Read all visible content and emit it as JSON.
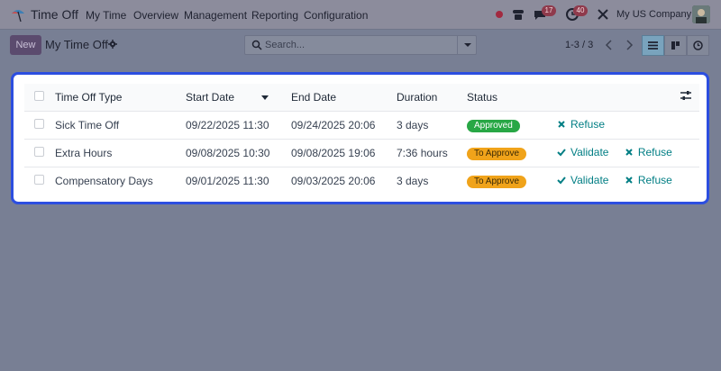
{
  "navbar": {
    "app_name": "Time Off",
    "menu": [
      "My Time",
      "Overview",
      "Management",
      "Reporting",
      "Configuration"
    ],
    "chat_badge": "17",
    "activity_badge": "40",
    "company": "My US Company"
  },
  "control_panel": {
    "new_label": "New",
    "breadcrumb": "My Time Off",
    "search_placeholder": "Search...",
    "pager": "1-3 / 3"
  },
  "table": {
    "columns": [
      "Time Off Type",
      "Start Date",
      "End Date",
      "Duration",
      "Status"
    ],
    "rows": [
      {
        "type": "Sick Time Off",
        "start": "09/22/2025 11:30",
        "end": "09/24/2025 20:06",
        "duration": "3 days",
        "status": "Approved",
        "actions": [
          "Refuse"
        ]
      },
      {
        "type": "Extra Hours",
        "start": "09/08/2025 10:30",
        "end": "09/08/2025 19:06",
        "duration": "7:36 hours",
        "status": "To Approve",
        "actions": [
          "Validate",
          "Refuse"
        ]
      },
      {
        "type": "Compensatory Days",
        "start": "09/01/2025 11:30",
        "end": "09/03/2025 20:06",
        "duration": "3 days",
        "status": "To Approve",
        "actions": [
          "Validate",
          "Refuse"
        ]
      }
    ]
  },
  "colors": {
    "accent": "#017e84",
    "approved": "#28a745",
    "to_approve": "#f0a31a",
    "highlight_border": "#2c4ee0"
  }
}
